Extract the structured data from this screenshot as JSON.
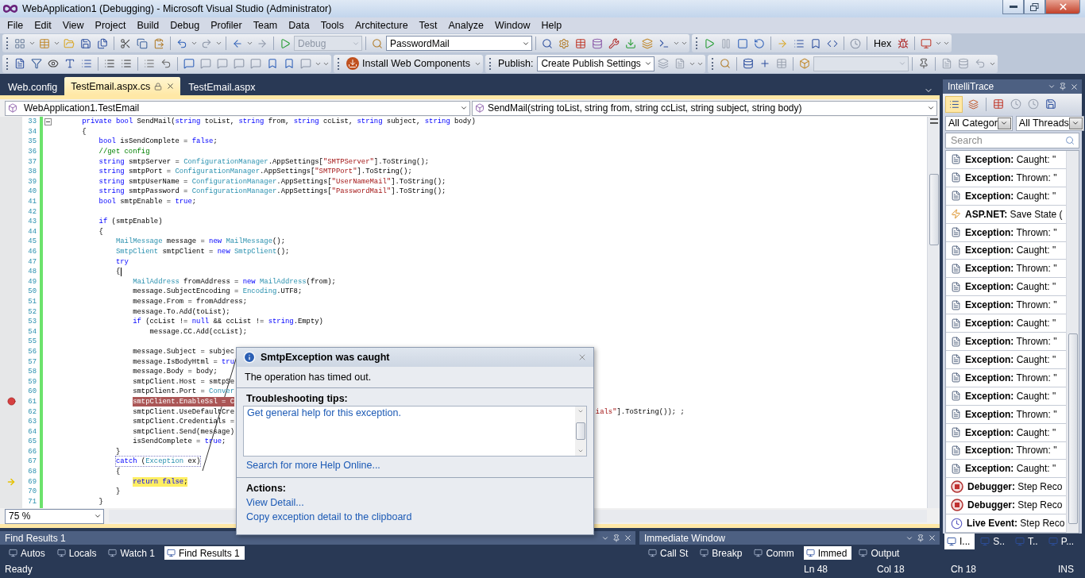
{
  "window": {
    "title": "WebApplication1 (Debugging) - Microsoft Visual Studio (Administrator)"
  },
  "menu": [
    "File",
    "Edit",
    "View",
    "Project",
    "Build",
    "Debug",
    "Profiler",
    "Team",
    "Data",
    "Tools",
    "Architecture",
    "Test",
    "Analyze",
    "Window",
    "Help"
  ],
  "toolbar": {
    "config": {
      "value": "Debug",
      "disabled": true
    },
    "find": {
      "value": "PasswordMail",
      "disabled": false
    },
    "hex": "Hex",
    "install": "Install Web Components",
    "publish_label": "Publish:",
    "publish": {
      "value": "Create Publish Settings",
      "disabled": false
    },
    "blank_combo": {
      "disabled": true
    }
  },
  "doc_tabs": [
    {
      "label": "Web.config",
      "selected": false,
      "locked": false
    },
    {
      "label": "TestEmail.aspx.cs",
      "selected": true,
      "locked": true
    },
    {
      "label": "TestEmail.aspx",
      "selected": false,
      "locked": false
    }
  ],
  "nav": {
    "type": "WebApplication1.TestEmail",
    "member": "SendMail(string toList, string from, string ccList, string subject, string body)"
  },
  "editor": {
    "zoom": "75 %",
    "lines": [
      {
        "n": "33",
        "kind": "normal",
        "fold": true,
        "code": [
          {
            "text": "    private bool",
            "kind": "kw"
          },
          {
            "text": " SendMail(",
            "kind": "p"
          },
          {
            "text": "string",
            "kind": "kw"
          },
          {
            "text": " toList, ",
            "kind": "p"
          },
          {
            "text": "string",
            "kind": "kw"
          },
          {
            "text": " from, ",
            "kind": "p"
          },
          {
            "text": "string",
            "kind": "kw"
          },
          {
            "text": " ccList, ",
            "kind": "p"
          },
          {
            "text": "string",
            "kind": "kw"
          },
          {
            "text": " subject, ",
            "kind": "p"
          },
          {
            "text": "string",
            "kind": "kw"
          },
          {
            "text": " body)",
            "kind": "p"
          }
        ]
      },
      {
        "n": "34",
        "kind": "normal",
        "fold": false,
        "code": [
          {
            "text": "    {",
            "kind": "p"
          }
        ]
      },
      {
        "n": "35",
        "kind": "normal",
        "fold": false,
        "code": [
          {
            "text": "        bool",
            "kind": "kw"
          },
          {
            "text": " isSendComplete = ",
            "kind": "p"
          },
          {
            "text": "false",
            "kind": "kw"
          },
          {
            "text": ";",
            "kind": "p"
          }
        ]
      },
      {
        "n": "36",
        "kind": "normal",
        "fold": false,
        "code": [
          {
            "text": "        //get config",
            "kind": "cm"
          }
        ]
      },
      {
        "n": "37",
        "kind": "normal",
        "fold": false,
        "code": [
          {
            "text": "        string",
            "kind": "kw"
          },
          {
            "text": " smtpServer = ",
            "kind": "p"
          },
          {
            "text": "ConfigurationManager",
            "kind": "ty"
          },
          {
            "text": ".AppSettings[",
            "kind": "p"
          },
          {
            "text": "\"SMTPServer\"",
            "kind": "str"
          },
          {
            "text": "].ToString();",
            "kind": "p"
          }
        ]
      },
      {
        "n": "38",
        "kind": "normal",
        "fold": false,
        "code": [
          {
            "text": "        string",
            "kind": "kw"
          },
          {
            "text": " smtpPort = ",
            "kind": "p"
          },
          {
            "text": "ConfigurationManager",
            "kind": "ty"
          },
          {
            "text": ".AppSettings[",
            "kind": "p"
          },
          {
            "text": "\"SMTPPort\"",
            "kind": "str"
          },
          {
            "text": "].ToString();",
            "kind": "p"
          }
        ]
      },
      {
        "n": "39",
        "kind": "normal",
        "fold": false,
        "code": [
          {
            "text": "        string",
            "kind": "kw"
          },
          {
            "text": " smtpUserName = ",
            "kind": "p"
          },
          {
            "text": "ConfigurationManager",
            "kind": "ty"
          },
          {
            "text": ".AppSettings[",
            "kind": "p"
          },
          {
            "text": "\"UserNameMail\"",
            "kind": "str"
          },
          {
            "text": "].ToString();",
            "kind": "p"
          }
        ]
      },
      {
        "n": "40",
        "kind": "normal",
        "fold": false,
        "code": [
          {
            "text": "        string",
            "kind": "kw"
          },
          {
            "text": " smtpPassword = ",
            "kind": "p"
          },
          {
            "text": "ConfigurationManager",
            "kind": "ty"
          },
          {
            "text": ".AppSettings[",
            "kind": "p"
          },
          {
            "text": "\"PasswordMail\"",
            "kind": "str"
          },
          {
            "text": "].ToString();",
            "kind": "p"
          }
        ]
      },
      {
        "n": "41",
        "kind": "normal",
        "fold": false,
        "code": [
          {
            "text": "        bool",
            "kind": "kw"
          },
          {
            "text": " smtpEnable = ",
            "kind": "p"
          },
          {
            "text": "true",
            "kind": "kw"
          },
          {
            "text": ";",
            "kind": "p"
          }
        ]
      },
      {
        "n": "42",
        "kind": "normal",
        "fold": false
      },
      {
        "n": "43",
        "kind": "normal",
        "fold": false,
        "code": [
          {
            "text": "        if",
            "kind": "kw"
          },
          {
            "text": " (smtpEnable)",
            "kind": "p"
          }
        ]
      },
      {
        "n": "44",
        "kind": "normal",
        "fold": false,
        "code": [
          {
            "text": "        {",
            "kind": "p"
          }
        ]
      },
      {
        "n": "45",
        "kind": "normal",
        "fold": false,
        "code": [
          {
            "text": "            MailMessage",
            "kind": "ty"
          },
          {
            "text": " message = ",
            "kind": "p"
          },
          {
            "text": "new",
            "kind": "kw"
          },
          {
            "text": " MailMessage",
            "kind": "ty"
          },
          {
            "text": "();",
            "kind": "p"
          }
        ]
      },
      {
        "n": "46",
        "kind": "normal",
        "fold": false,
        "code": [
          {
            "text": "            SmtpClient",
            "kind": "ty"
          },
          {
            "text": " smtpClient = ",
            "kind": "p"
          },
          {
            "text": "new",
            "kind": "kw"
          },
          {
            "text": " SmtpClient",
            "kind": "ty"
          },
          {
            "text": "();",
            "kind": "p"
          }
        ]
      },
      {
        "n": "47",
        "kind": "normal",
        "fold": false,
        "code": [
          {
            "text": "            try",
            "kind": "kw"
          }
        ]
      },
      {
        "n": "48",
        "kind": "caret",
        "fold": false,
        "code": [
          {
            "text": "            {",
            "kind": "p"
          }
        ]
      },
      {
        "n": "49",
        "kind": "normal",
        "fold": false,
        "code": [
          {
            "text": "                MailAddress",
            "kind": "ty"
          },
          {
            "text": " fromAddress = ",
            "kind": "p"
          },
          {
            "text": "new",
            "kind": "kw"
          },
          {
            "text": " MailAddress",
            "kind": "ty"
          },
          {
            "text": "(from);",
            "kind": "p"
          }
        ]
      },
      {
        "n": "50",
        "kind": "normal",
        "fold": false,
        "code": [
          {
            "text": "                message.SubjectEncoding = ",
            "kind": "p"
          },
          {
            "text": "Encoding",
            "kind": "ty"
          },
          {
            "text": ".UTF8;",
            "kind": "p"
          }
        ]
      },
      {
        "n": "51",
        "kind": "normal",
        "fold": false,
        "code": [
          {
            "text": "                message.From = fromAddress;",
            "kind": "p"
          }
        ]
      },
      {
        "n": "52",
        "kind": "normal",
        "fold": false,
        "code": [
          {
            "text": "                message.To.Add(toList);",
            "kind": "p"
          }
        ]
      },
      {
        "n": "53",
        "kind": "normal",
        "fold": false,
        "code": [
          {
            "text": "                if",
            "kind": "kw"
          },
          {
            "text": " (ccList != ",
            "kind": "p"
          },
          {
            "text": "null",
            "kind": "kw"
          },
          {
            "text": " && ccList != ",
            "kind": "p"
          },
          {
            "text": "string",
            "kind": "kw"
          },
          {
            "text": ".Empty)",
            "kind": "p"
          }
        ]
      },
      {
        "n": "54",
        "kind": "normal",
        "fold": false,
        "code": [
          {
            "text": "                    message.CC.Add(ccList);",
            "kind": "p"
          }
        ]
      },
      {
        "n": "55",
        "kind": "normal",
        "fold": false
      },
      {
        "n": "56",
        "kind": "normal",
        "fold": false,
        "code": [
          {
            "text": "                message.Subject = subjec",
            "kind": "p"
          }
        ]
      },
      {
        "n": "57",
        "kind": "normal",
        "fold": false,
        "code": [
          {
            "text": "                message.IsBodyHtml = ",
            "kind": "p"
          },
          {
            "text": "tru",
            "kind": "kw"
          }
        ]
      },
      {
        "n": "58",
        "kind": "normal",
        "fold": false,
        "code": [
          {
            "text": "                message.Body = body;",
            "kind": "p"
          }
        ]
      },
      {
        "n": "59",
        "kind": "normal",
        "fold": false,
        "code": [
          {
            "text": "                smtpClient.Host = smtpSe",
            "kind": "p"
          }
        ]
      },
      {
        "n": "60",
        "kind": "normal",
        "fold": false,
        "code": [
          {
            "text": "                smtpClient.Port = ",
            "kind": "p"
          },
          {
            "text": "Conver",
            "kind": "ty"
          }
        ]
      },
      {
        "n": "61",
        "kind": "breakpoint",
        "fold": false,
        "code": [
          {
            "text": "                smtpClient.EnableSsl = C",
            "kind": "p"
          }
        ]
      },
      {
        "n": "62",
        "kind": "normal",
        "fold": false,
        "code": [
          {
            "text": "                smtpClient.UseDefaultCre",
            "kind": "p"
          }
        ],
        "tail": [
          {
            "text": "ials\"",
            "kind": "str"
          },
          {
            "text": "].ToString()); ;",
            "kind": "p"
          }
        ]
      },
      {
        "n": "63",
        "kind": "normal",
        "fold": false,
        "code": [
          {
            "text": "                smtpClient.Credentials =",
            "kind": "p"
          }
        ]
      },
      {
        "n": "64",
        "kind": "normal",
        "fold": false,
        "code": [
          {
            "text": "                smtpClient.Send(message)",
            "kind": "p"
          }
        ]
      },
      {
        "n": "65",
        "kind": "normal",
        "fold": false,
        "code": [
          {
            "text": "                isSendComplete = ",
            "kind": "p"
          },
          {
            "text": "true",
            "kind": "kw"
          },
          {
            "text": ";",
            "kind": "p"
          }
        ]
      },
      {
        "n": "66",
        "kind": "normal",
        "fold": false,
        "code": [
          {
            "text": "            }",
            "kind": "p"
          }
        ]
      },
      {
        "n": "67",
        "kind": "exception",
        "fold": false,
        "code": [
          {
            "text": "            catch",
            "kind": "kw"
          },
          {
            "text": " (",
            "kind": "p"
          },
          {
            "text": "Exception",
            "kind": "ty"
          },
          {
            "text": " ex)",
            "kind": "p"
          }
        ]
      },
      {
        "n": "68",
        "kind": "normal",
        "fold": false,
        "code": [
          {
            "text": "            {",
            "kind": "p"
          }
        ]
      },
      {
        "n": "69",
        "kind": "current",
        "fold": false,
        "code": [
          {
            "text": "                return false",
            "kind": "kw"
          },
          {
            "text": ";",
            "kind": "p"
          }
        ]
      },
      {
        "n": "70",
        "kind": "normal",
        "fold": false,
        "code": [
          {
            "text": "            }",
            "kind": "p"
          }
        ]
      },
      {
        "n": "71",
        "kind": "normal",
        "fold": false,
        "code": [
          {
            "text": "        }",
            "kind": "p"
          }
        ]
      }
    ]
  },
  "exception_helper": {
    "title": "SmtpException was caught",
    "message": "The operation has timed out.",
    "tips_heading": "Troubleshooting tips:",
    "tips": [
      "Get general help for this exception."
    ],
    "help_link": "Search for more Help Online...",
    "actions_heading": "Actions:",
    "actions": [
      "View Detail...",
      "Copy exception detail to the clipboard"
    ]
  },
  "intellitrace": {
    "title": "IntelliTrace",
    "views": [
      {
        "selected": true
      },
      {
        "selected": false
      }
    ],
    "category": "All Categor",
    "thread": "All Threads",
    "search": {
      "placeholder": "Search"
    },
    "events": [
      {
        "kind": "exception",
        "text": "**Exception:** Caught: \""
      },
      {
        "kind": "exception",
        "text": "**Exception:** Thrown: \""
      },
      {
        "kind": "exception",
        "text": "**Exception:** Caught: \""
      },
      {
        "kind": "aspnet",
        "text": "**ASP.NET:** Save State ("
      },
      {
        "kind": "exception",
        "text": "**Exception:** Thrown: \""
      },
      {
        "kind": "exception",
        "text": "**Exception:** Caught: \""
      },
      {
        "kind": "exception",
        "text": "**Exception:** Thrown: \""
      },
      {
        "kind": "exception",
        "text": "**Exception:** Caught: \""
      },
      {
        "kind": "exception",
        "text": "**Exception:** Thrown: \""
      },
      {
        "kind": "exception",
        "text": "**Exception:** Caught: \""
      },
      {
        "kind": "exception",
        "text": "**Exception:** Thrown: \""
      },
      {
        "kind": "exception",
        "text": "**Exception:** Caught: \""
      },
      {
        "kind": "exception",
        "text": "**Exception:** Thrown: \""
      },
      {
        "kind": "exception",
        "text": "**Exception:** Caught: \""
      },
      {
        "kind": "exception",
        "text": "**Exception:** Thrown: \""
      },
      {
        "kind": "exception",
        "text": "**Exception:** Caught: \""
      },
      {
        "kind": "exception",
        "text": "**Exception:** Thrown: \""
      },
      {
        "kind": "exception",
        "text": "**Exception:** Caught: \""
      },
      {
        "kind": "debugger",
        "text": "**Debugger:** Step Reco"
      },
      {
        "kind": "debugger",
        "text": "**Debugger:** Step Reco"
      },
      {
        "kind": "live",
        "text": "**Live Event:** Step Reco"
      }
    ],
    "tabs": [
      {
        "label": "I...",
        "selected": true
      },
      {
        "label": "S..",
        "selected": false
      },
      {
        "label": "T..",
        "selected": false
      },
      {
        "label": "P...",
        "selected": false
      }
    ]
  },
  "bottom_left": {
    "title": "Find Results 1",
    "tabs": [
      {
        "label": "Autos",
        "selected": false
      },
      {
        "label": "Locals",
        "selected": false
      },
      {
        "label": "Watch 1",
        "selected": false
      },
      {
        "label": "Find Results 1",
        "selected": true
      }
    ]
  },
  "bottom_right": {
    "title": "Immediate Window",
    "tabs": [
      {
        "label": "Call St",
        "selected": false
      },
      {
        "label": "Breakp",
        "selected": false
      },
      {
        "label": "Comm",
        "selected": false
      },
      {
        "label": "Immed",
        "selected": true
      },
      {
        "label": "Output",
        "selected": false
      }
    ]
  },
  "status": {
    "text": "Ready",
    "line": "Ln 48",
    "col": "Col 18",
    "ch": "Ch 18",
    "mode": "INS"
  }
}
